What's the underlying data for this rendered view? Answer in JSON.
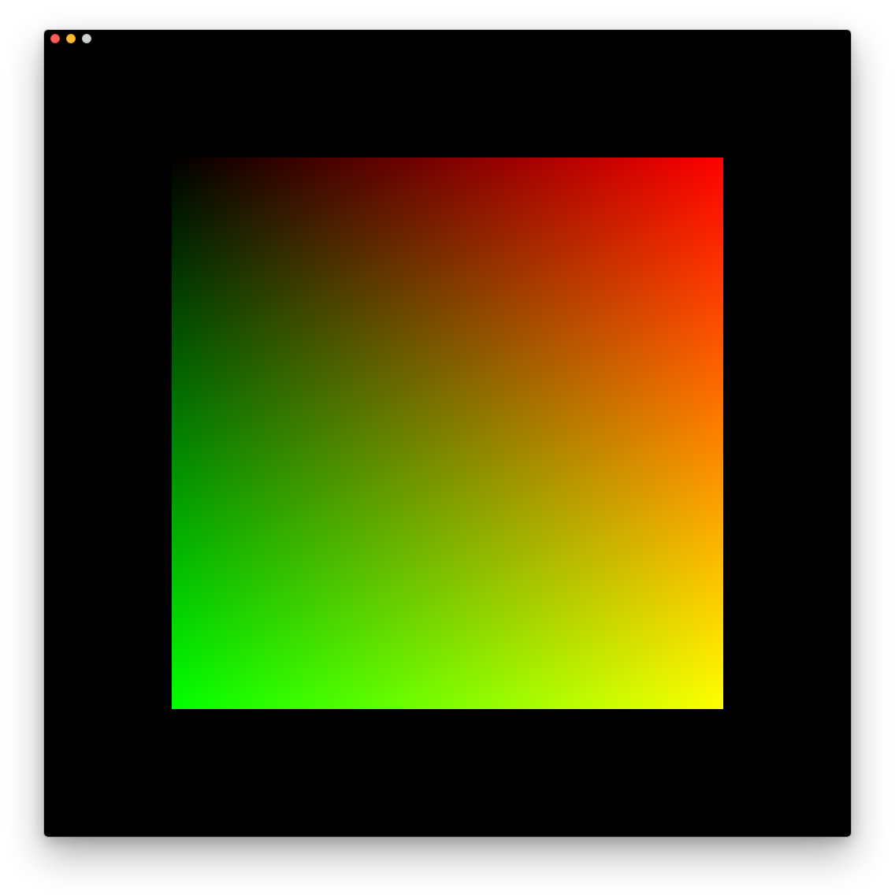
{
  "window": {
    "background_color": "#000000",
    "traffic_lights": [
      {
        "name": "close",
        "color": "#ff5f57"
      },
      {
        "name": "minimize",
        "color": "#febc2e"
      },
      {
        "name": "zoom",
        "color": "#cfcfcf"
      }
    ]
  },
  "quad": {
    "corner_colors": {
      "top_left": "#000000",
      "top_right": "#ff0000",
      "bottom_left": "#00ff00",
      "bottom_right": "#ffff00"
    }
  }
}
